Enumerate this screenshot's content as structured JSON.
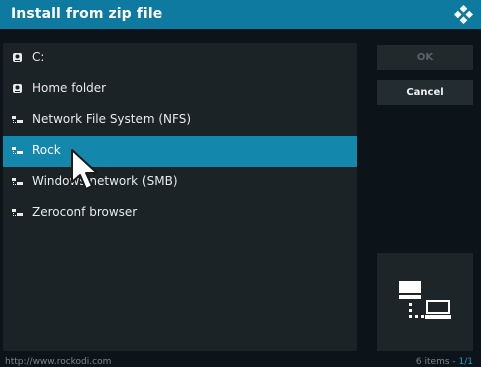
{
  "dialog": {
    "title": "Install from zip file"
  },
  "sources": [
    {
      "label": "C:",
      "icon": "drive-icon",
      "selected": false
    },
    {
      "label": "Home folder",
      "icon": "drive-icon",
      "selected": false
    },
    {
      "label": "Network File System (NFS)",
      "icon": "network-share-icon",
      "selected": false
    },
    {
      "label": "Rock",
      "icon": "network-share-icon",
      "selected": true
    },
    {
      "label": "Windows network (SMB)",
      "icon": "network-share-icon",
      "selected": false
    },
    {
      "label": "Zeroconf browser",
      "icon": "network-share-icon",
      "selected": false
    }
  ],
  "buttons": {
    "ok": "OK",
    "cancel": "Cancel"
  },
  "preview": {
    "icon": "network-icon"
  },
  "footer": {
    "url": "http://www.rockodi.com",
    "items_text": "6 items - ",
    "page_text": "1/1"
  },
  "colors": {
    "accent": "#1487ad",
    "titlebar": "#0f7aa0",
    "panel": "#1b2327",
    "background": "#0d1419"
  }
}
